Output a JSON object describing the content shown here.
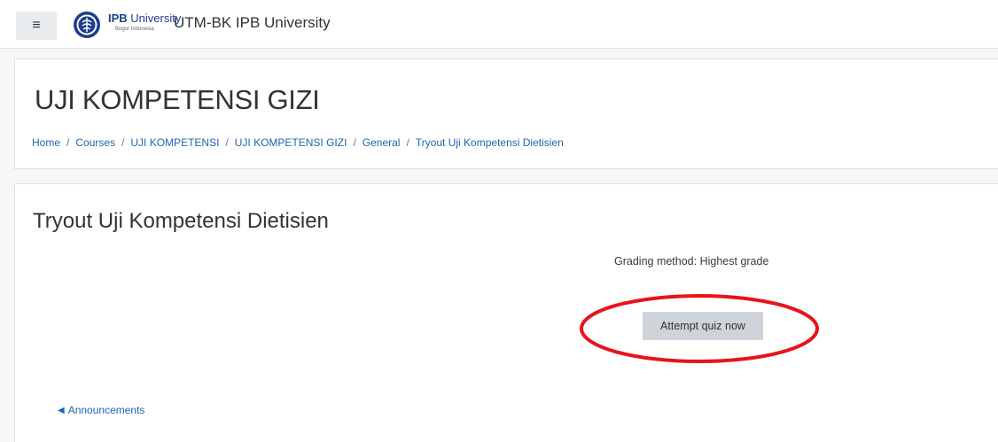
{
  "navbar": {
    "menu_icon": "hamburger-icon",
    "logo_icon": "ipb-seal-icon",
    "brand_ipb": "IPB",
    "brand_university": "University",
    "brand_subtitle": "Bogor Indonesia",
    "site_name": "UTM-BK IPB University"
  },
  "header": {
    "title": "UJI KOMPETENSI GIZI",
    "breadcrumb": [
      "Home",
      "Courses",
      "UJI KOMPETENSI",
      "UJI KOMPETENSI GIZI",
      "General",
      "Tryout Uji Kompetensi Dietisien"
    ],
    "separator": "/"
  },
  "main": {
    "activity_title": "Tryout Uji Kompetensi Dietisien",
    "grading_method": "Grading method: Highest grade",
    "attempt_button": "Attempt quiz now",
    "prev_activity_icon": "arrow-left-icon",
    "prev_activity": "Announcements"
  },
  "colors": {
    "link": "#1d66b3",
    "highlight": "#e8131b",
    "button_bg": "#ced4da"
  }
}
